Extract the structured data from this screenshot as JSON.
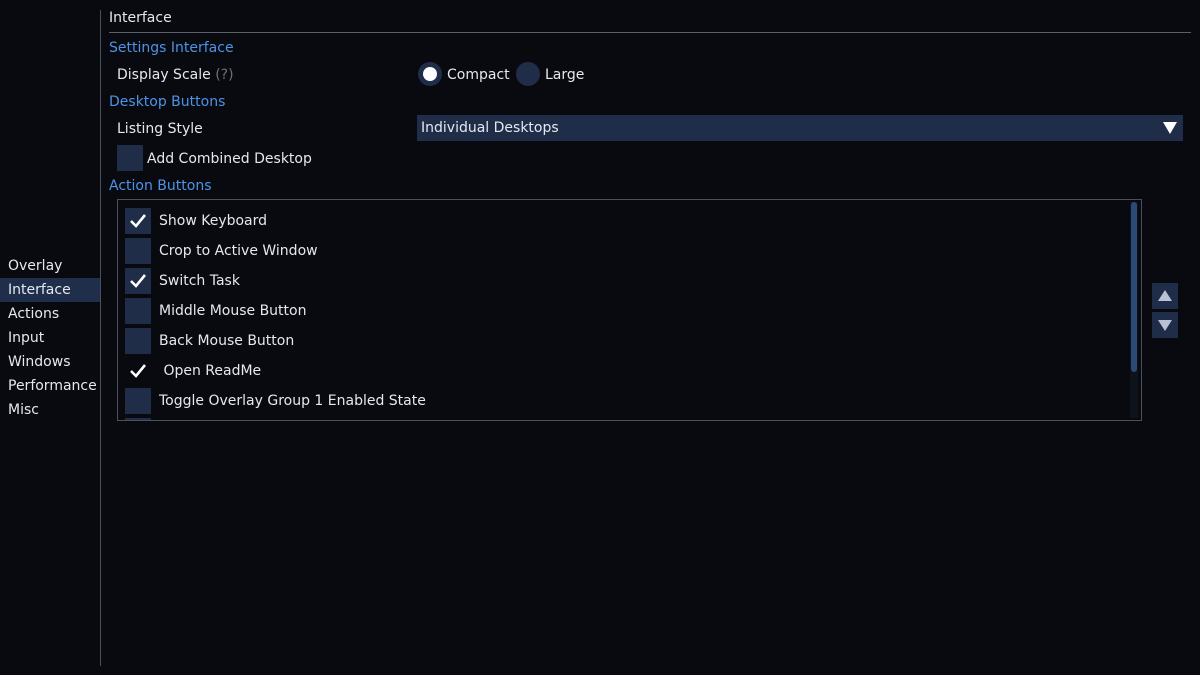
{
  "sidebar": {
    "items": [
      {
        "label": "Overlay",
        "active": false
      },
      {
        "label": "Interface",
        "active": true
      },
      {
        "label": "Actions",
        "active": false
      },
      {
        "label": "Input",
        "active": false
      },
      {
        "label": "Windows",
        "active": false
      },
      {
        "label": "Performance",
        "active": false
      },
      {
        "label": "Misc",
        "active": false
      }
    ]
  },
  "main": {
    "title": "Interface",
    "settings_interface": {
      "header": "Settings Interface",
      "display_scale_label": "Display Scale",
      "display_scale_hint": "(?)",
      "options": [
        {
          "label": "Compact",
          "checked": true
        },
        {
          "label": "Large",
          "checked": false
        }
      ]
    },
    "desktop_buttons": {
      "header": "Desktop Buttons",
      "listing_style_label": "Listing Style",
      "listing_style_value": "Individual Desktops",
      "add_combined_label": "Add Combined Desktop",
      "add_combined_checked": false
    },
    "action_buttons": {
      "header": "Action Buttons",
      "items": [
        {
          "label": "Show Keyboard",
          "checked": true
        },
        {
          "label": "Crop to Active Window",
          "checked": false
        },
        {
          "label": "Switch Task",
          "checked": true
        },
        {
          "label": "Middle Mouse Button",
          "checked": false
        },
        {
          "label": "Back Mouse Button",
          "checked": false
        },
        {
          "label": " Open ReadMe",
          "checked": true
        },
        {
          "label": "Toggle Overlay Group 1 Enabled State",
          "checked": false
        }
      ]
    }
  },
  "colors": {
    "accent": "#4c94e8",
    "control_bg": "#1f2d48",
    "background": "#080a0f"
  },
  "icons": {
    "check": "checkmark-icon",
    "dropdown": "triangle-down-icon",
    "up": "triangle-up-icon",
    "down": "triangle-down-icon"
  }
}
